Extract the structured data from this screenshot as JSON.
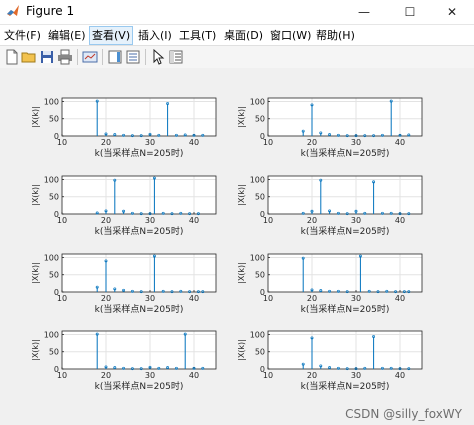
{
  "window": {
    "title": "Figure 1",
    "minimize": "—",
    "maximize": "☐",
    "close": "✕"
  },
  "menu": [
    {
      "label": "文件(F)"
    },
    {
      "label": "编辑(E)"
    },
    {
      "label": "查看(V)"
    },
    {
      "label": "插入(I)"
    },
    {
      "label": "工具(T)"
    },
    {
      "label": "桌面(D)"
    },
    {
      "label": "窗口(W)"
    },
    {
      "label": "帮助(H)"
    }
  ],
  "toolbar": {
    "icons": [
      "new-figure-icon",
      "open-icon",
      "save-icon",
      "print-icon",
      "link-plot-icon",
      "insert-colorbar-icon",
      "insert-legend-icon",
      "pointer-icon",
      "property-inspector-icon"
    ]
  },
  "colors": {
    "stem": "#0072bd",
    "axes_bg": "#ffffff",
    "figure_bg": "#f0f0f0",
    "grid": "#e3e3e3"
  },
  "watermark": "CSDN @silly_foxWY",
  "chart_data": [
    {
      "type": "stem",
      "xlabel": "k(当采样点N=205时)",
      "ylabel": "|X(k)|",
      "xlim": [
        10,
        45
      ],
      "ylim": [
        0,
        110
      ],
      "xticks": [
        10,
        20,
        30,
        40
      ],
      "yticks": [
        0,
        50,
        100
      ],
      "grid": true,
      "x": [
        18,
        20,
        22,
        24,
        26,
        28,
        30,
        32,
        34,
        36,
        38,
        40,
        42
      ],
      "y": [
        101,
        6,
        4,
        2,
        1,
        1,
        5,
        2,
        94,
        2,
        3,
        2,
        2
      ]
    },
    {
      "type": "stem",
      "xlabel": "k(当采样点N=205时)",
      "ylabel": "|X(k)|",
      "xlim": [
        10,
        45
      ],
      "ylim": [
        0,
        110
      ],
      "xticks": [
        10,
        20,
        30,
        40
      ],
      "yticks": [
        0,
        50,
        100
      ],
      "grid": true,
      "x": [
        18,
        20,
        22,
        24,
        26,
        28,
        30,
        32,
        34,
        36,
        38,
        40,
        42
      ],
      "y": [
        14,
        90,
        9,
        4,
        2,
        1,
        1,
        1,
        1,
        2,
        101,
        2,
        3
      ]
    },
    {
      "type": "stem",
      "xlabel": "k(当采样点N=205时)",
      "ylabel": "|X(k)|",
      "xlim": [
        10,
        45
      ],
      "ylim": [
        0,
        110
      ],
      "xticks": [
        10,
        20,
        30,
        40
      ],
      "yticks": [
        0,
        50,
        100
      ],
      "grid": true,
      "x": [
        18,
        20,
        22,
        24,
        26,
        28,
        30,
        31,
        33,
        35,
        37,
        39,
        41
      ],
      "y": [
        3,
        9,
        98,
        8,
        2,
        1,
        1,
        104,
        2,
        1,
        2,
        1,
        1
      ]
    },
    {
      "type": "stem",
      "xlabel": "k(当采样点N=205时)",
      "ylabel": "|X(k)|",
      "xlim": [
        10,
        45
      ],
      "ylim": [
        0,
        110
      ],
      "xticks": [
        10,
        20,
        30,
        40
      ],
      "yticks": [
        0,
        50,
        100
      ],
      "grid": true,
      "x": [
        18,
        20,
        22,
        24,
        26,
        28,
        30,
        32,
        34,
        36,
        38,
        40,
        42
      ],
      "y": [
        2,
        8,
        98,
        9,
        2,
        1,
        8,
        2,
        93,
        2,
        2,
        1,
        1
      ]
    },
    {
      "type": "stem",
      "xlabel": "k(当采样点N=205时)",
      "ylabel": "|X(k)|",
      "xlim": [
        10,
        45
      ],
      "ylim": [
        0,
        110
      ],
      "xticks": [
        10,
        20,
        30,
        40
      ],
      "yticks": [
        0,
        50,
        100
      ],
      "grid": true,
      "x": [
        18,
        20,
        22,
        24,
        26,
        28,
        31,
        33,
        35,
        37,
        39,
        41,
        42
      ],
      "y": [
        14,
        90,
        9,
        5,
        2,
        1,
        104,
        2,
        1,
        2,
        1,
        1,
        1
      ]
    },
    {
      "type": "stem",
      "xlabel": "k(当采样点N=205时)",
      "ylabel": "|X(k)|",
      "xlim": [
        10,
        45
      ],
      "ylim": [
        0,
        110
      ],
      "xticks": [
        10,
        20,
        30,
        40
      ],
      "yticks": [
        0,
        50,
        100
      ],
      "grid": true,
      "x": [
        18,
        20,
        22,
        24,
        26,
        28,
        31,
        33,
        35,
        37,
        39,
        41,
        42
      ],
      "y": [
        98,
        6,
        4,
        2,
        2,
        1,
        104,
        2,
        1,
        2,
        1,
        1,
        1
      ]
    },
    {
      "type": "stem",
      "xlabel": "k(当采样点N=205时)",
      "ylabel": "|X(k)|",
      "xlim": [
        10,
        45
      ],
      "ylim": [
        0,
        110
      ],
      "xticks": [
        10,
        20,
        30,
        40
      ],
      "yticks": [
        0,
        50,
        100
      ],
      "grid": true,
      "x": [
        18,
        20,
        22,
        24,
        26,
        28,
        30,
        32,
        34,
        36,
        38,
        40,
        42
      ],
      "y": [
        101,
        6,
        4,
        2,
        1,
        1,
        5,
        2,
        4,
        2,
        101,
        2,
        2
      ]
    },
    {
      "type": "stem",
      "xlabel": "k(当采样点N=205时)",
      "ylabel": "|X(k)|",
      "xlim": [
        10,
        45
      ],
      "ylim": [
        0,
        110
      ],
      "xticks": [
        10,
        20,
        30,
        40
      ],
      "yticks": [
        0,
        50,
        100
      ],
      "grid": true,
      "x": [
        18,
        20,
        22,
        24,
        26,
        28,
        30,
        32,
        34,
        36,
        38,
        40,
        42
      ],
      "y": [
        14,
        90,
        9,
        4,
        2,
        1,
        1,
        2,
        94,
        2,
        2,
        1,
        1
      ]
    }
  ]
}
